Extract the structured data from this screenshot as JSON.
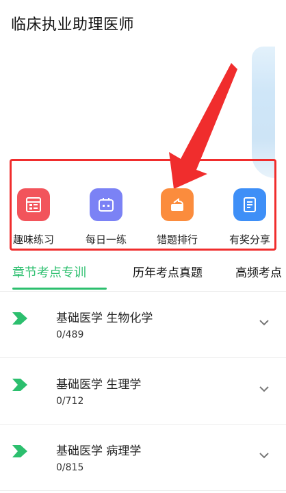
{
  "header": {
    "title": "临床执业助理医师"
  },
  "quick_actions": [
    {
      "label": "趣味练习",
      "icon": "fun-practice-icon",
      "color": "#f2545b"
    },
    {
      "label": "每日一练",
      "icon": "daily-practice-icon",
      "color": "#7b82f5"
    },
    {
      "label": "错题排行",
      "icon": "wrong-ranking-icon",
      "color": "#fb8c3d"
    },
    {
      "label": "有奖分享",
      "icon": "reward-share-icon",
      "color": "#3e8ff7"
    }
  ],
  "tabs": [
    {
      "label": "章节考点专训",
      "active": true
    },
    {
      "label": "历年考点真题",
      "active": false
    },
    {
      "label": "高频考点",
      "active": false
    }
  ],
  "chapters": [
    {
      "title": "基础医学  生物化学",
      "progress": "0/489"
    },
    {
      "title": "基础医学  生理学",
      "progress": "0/712"
    },
    {
      "title": "基础医学  病理学",
      "progress": "0/815"
    }
  ],
  "colors": {
    "accent": "#2cbf6e",
    "highlight": "#f02d2d",
    "arrow": "#f02d2d"
  }
}
